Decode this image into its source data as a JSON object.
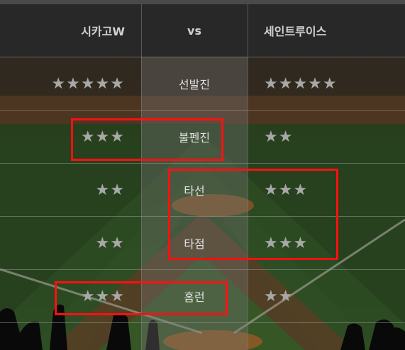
{
  "header": {
    "team_left": "시카고W",
    "versus": "vs",
    "team_right": "세인트루이스"
  },
  "rows": [
    {
      "label": "선발진",
      "left_stars": "★★★★★",
      "right_stars": "★★★★★"
    },
    {
      "label": "불펜진",
      "left_stars": "★★★",
      "right_stars": "★★"
    },
    {
      "label": "타선",
      "left_stars": "★★",
      "right_stars": "★★★"
    },
    {
      "label": "타점",
      "left_stars": "★★",
      "right_stars": "★★★"
    },
    {
      "label": "홈런",
      "left_stars": "★★★",
      "right_stars": "★★"
    }
  ],
  "colors": {
    "highlight": "#ff1010",
    "star": "#a8a8a8",
    "header_bg": "#282828"
  }
}
